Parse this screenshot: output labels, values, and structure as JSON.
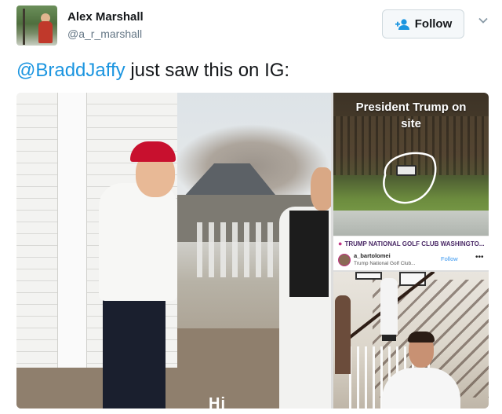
{
  "tweet": {
    "author": {
      "name": "Alex Marshall",
      "handle": "@a_r_marshall"
    },
    "follow_button": {
      "label": "Follow",
      "icon": "add-user-icon"
    },
    "menu_icon": "chevron-down-icon",
    "text": {
      "mention": "@BraddJaffy",
      "body": " just saw this on IG:"
    }
  },
  "media": {
    "left_caption": "Hi",
    "right_top": {
      "title_line1": "President Trump on",
      "title_line2": "site",
      "instagram_bar": {
        "location": "TRUMP NATIONAL GOLF CLUB WASHINGTO...",
        "location_icon": "pin-icon",
        "username": "a_bartolomei",
        "subtitle": "Trump National Golf Club...",
        "follow_label": "Follow",
        "more_label": "•••"
      }
    }
  },
  "colors": {
    "link": "#1b95e0",
    "follow_border": "#cfd9de",
    "hat": "#c8102e"
  }
}
